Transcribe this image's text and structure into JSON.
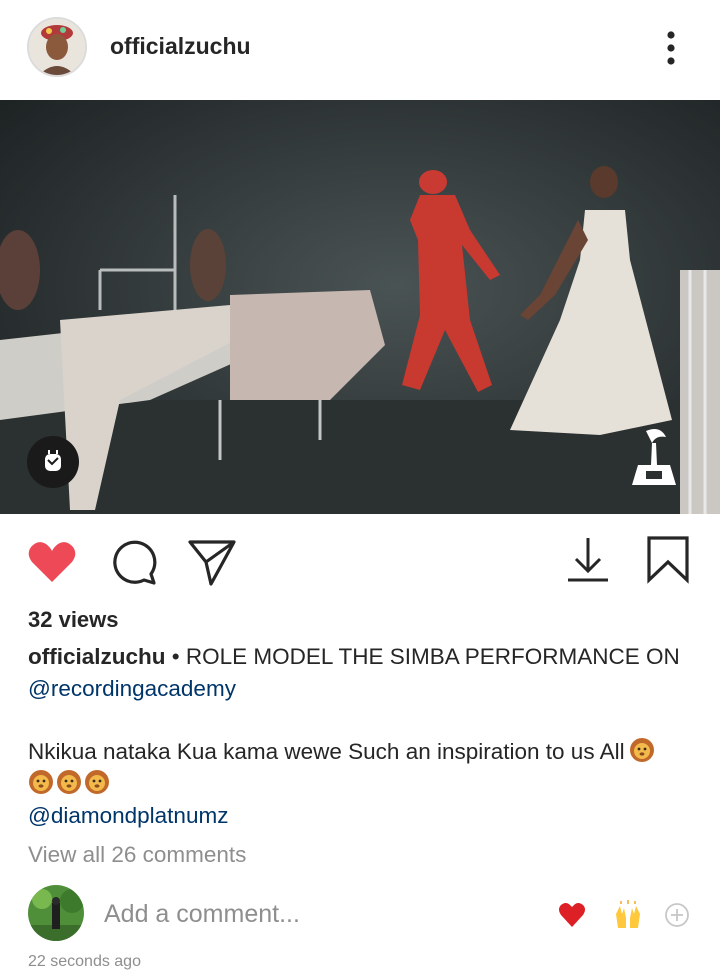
{
  "post": {
    "username": "officialzuchu",
    "views": "32 views",
    "caption_user": "officialzuchu",
    "caption_text": "• ROLE MODEL THE SIMBA PERFORMANCE ON",
    "caption_mention": "@recordingacademy",
    "body_text": "Nkikua nataka Kua kama wewe Such an inspiration to us All",
    "body_mention": "@diamondplatnumz",
    "view_all": "View all 26 comments",
    "comment_placeholder": "Add a comment...",
    "timestamp": "22 seconds ago"
  },
  "icons": {
    "more": "more-vertical-icon",
    "sound": "sound-toggle-icon",
    "like": "heart-icon",
    "comment": "comment-bubble-icon",
    "share": "paper-plane-icon",
    "download": "download-icon",
    "save": "bookmark-icon",
    "grammy": "grammy-logo",
    "emoji": "lion-emoji",
    "quick_heart": "red-heart-emoji",
    "quick_hands": "raising-hands-emoji",
    "add_reaction": "plus-circle-icon"
  },
  "colors": {
    "like_red": "#ed4956",
    "link_blue": "#003569",
    "muted_gray": "#8e8e8e",
    "text_dark": "#262626"
  }
}
